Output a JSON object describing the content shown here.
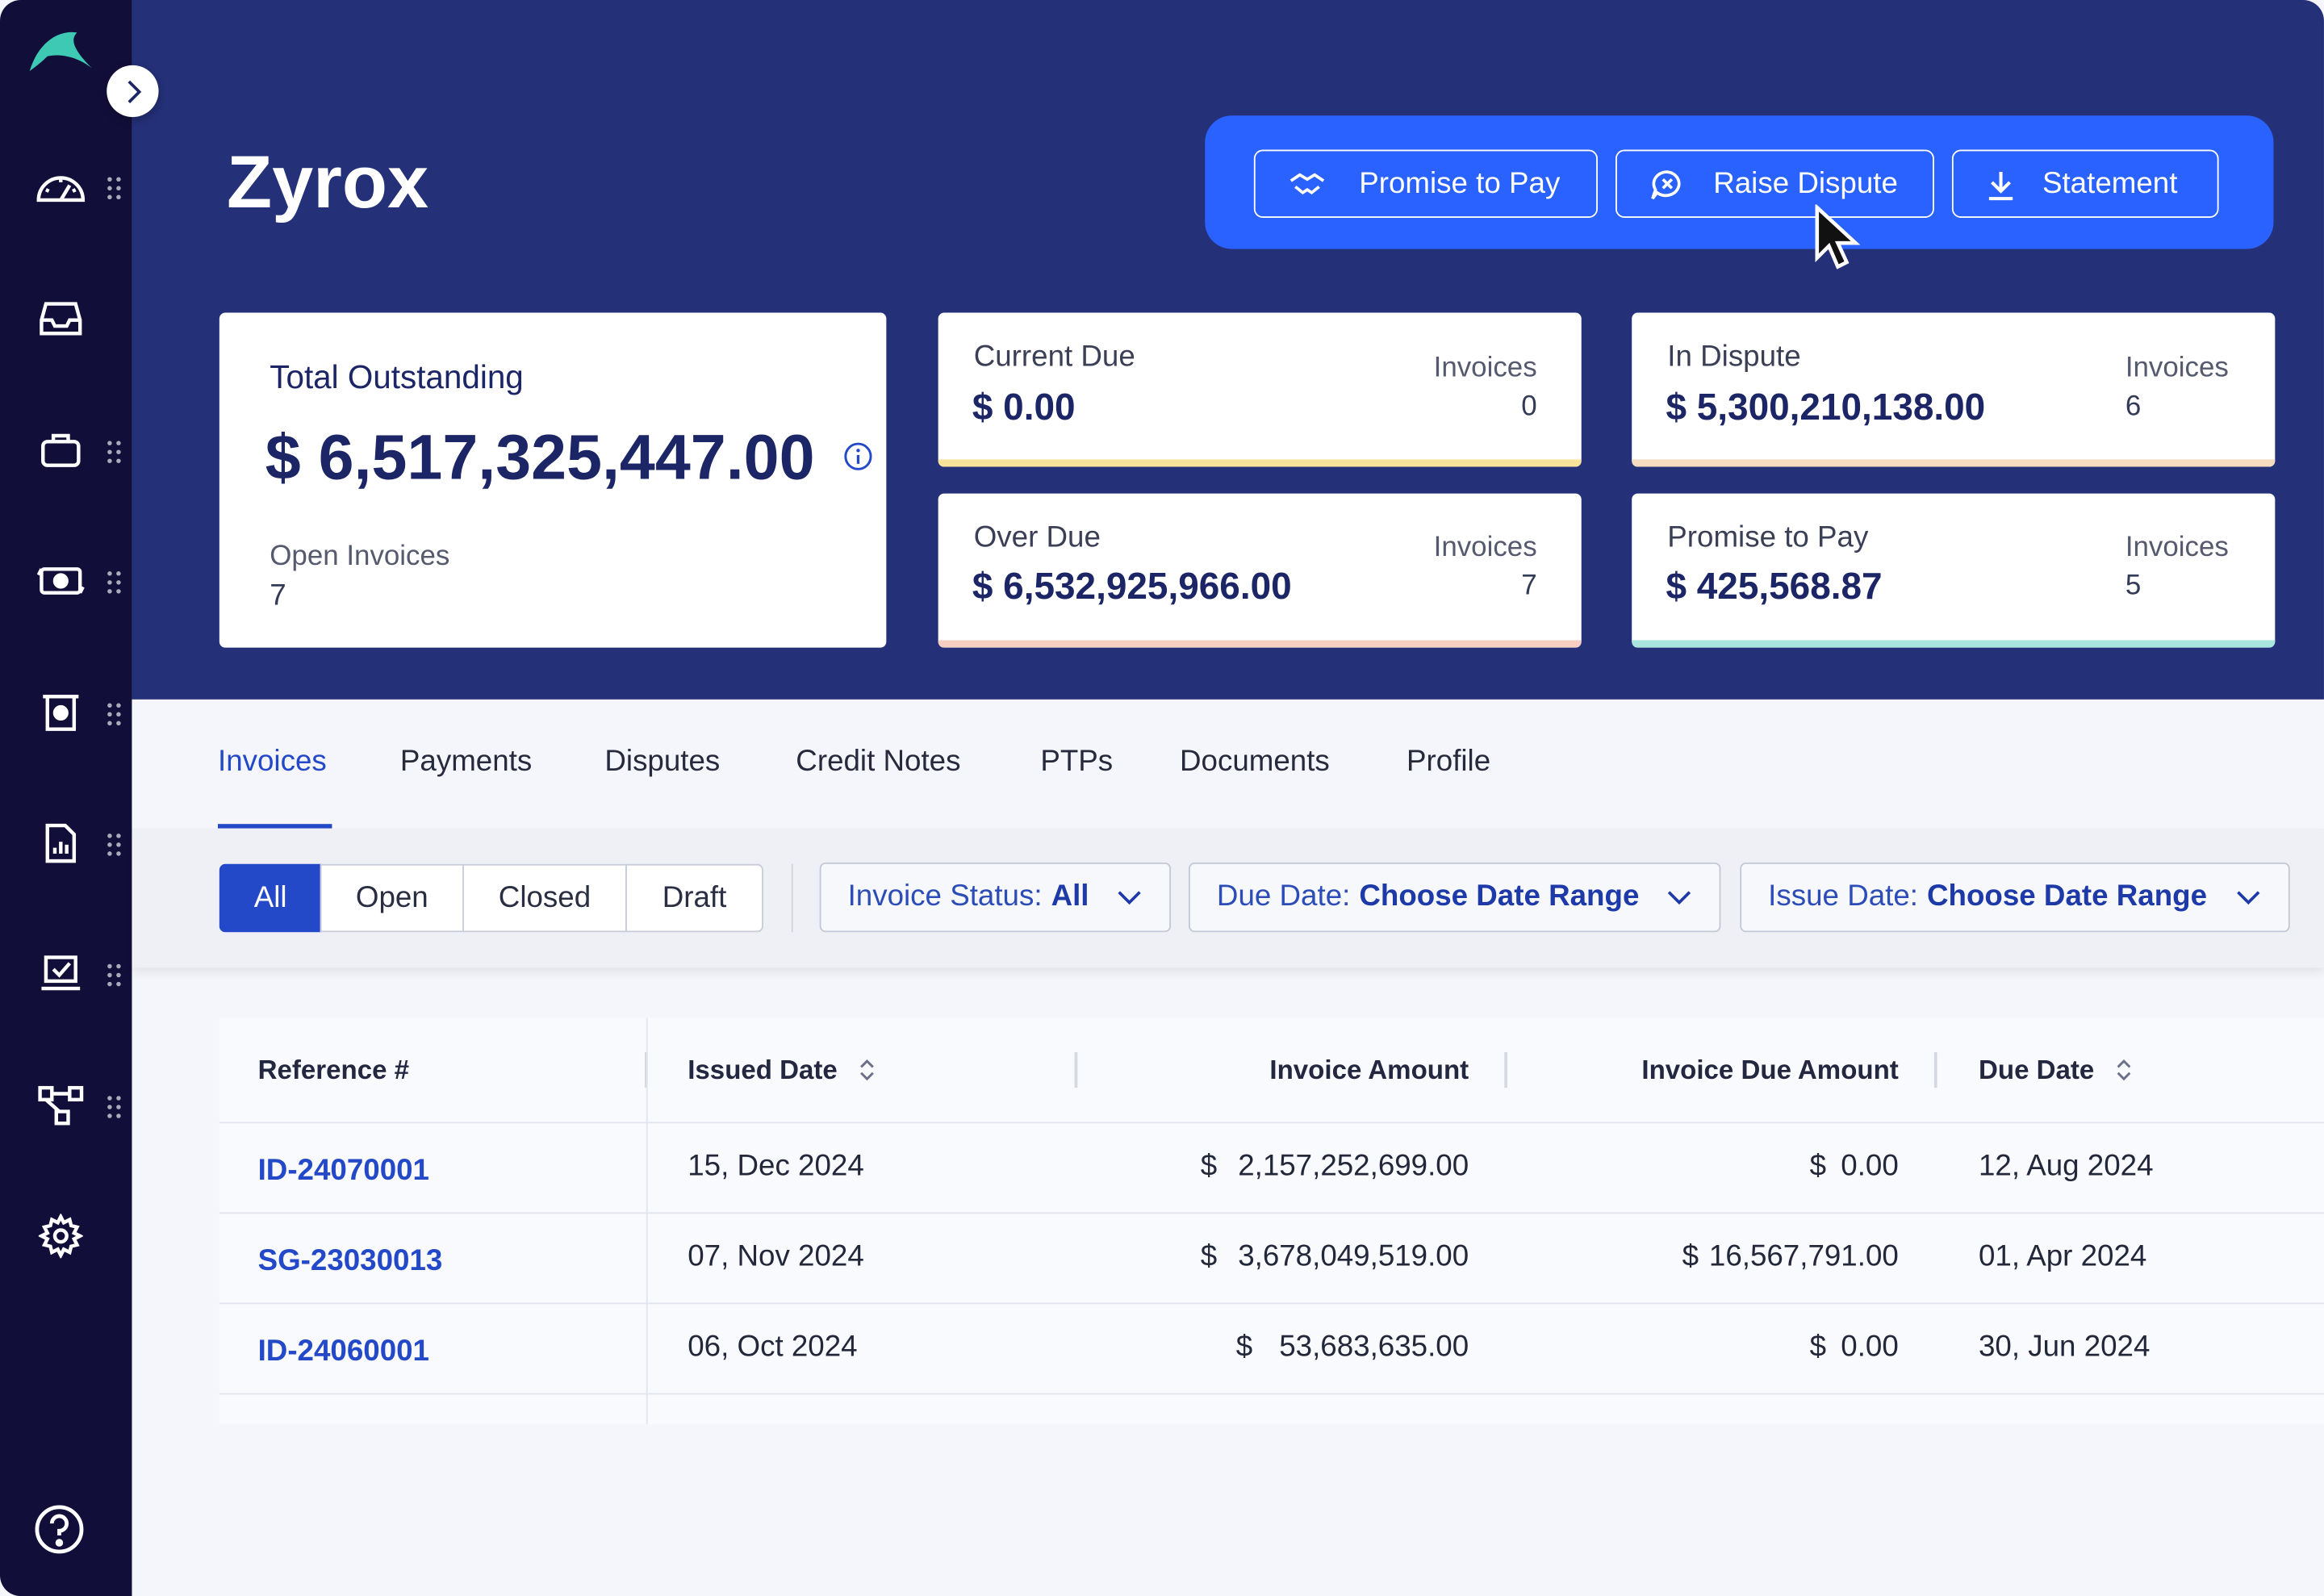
{
  "company": {
    "name": "Zyrox"
  },
  "actions": {
    "promise_to_pay": "Promise to Pay",
    "raise_dispute": "Raise Dispute",
    "statement": "Statement"
  },
  "summary": {
    "total_outstanding": {
      "label": "Total Outstanding",
      "amount": "$ 6,517,325,447.00",
      "open_invoices_label": "Open Invoices",
      "open_invoices": "7"
    },
    "current_due": {
      "label": "Current Due",
      "amount": "$ 0.00",
      "invoices_label": "Invoices",
      "invoices": "0",
      "color": "#f7e39a"
    },
    "in_dispute": {
      "label": "In Dispute",
      "amount": "$ 5,300,210,138.00",
      "invoices_label": "Invoices",
      "invoices": "6",
      "color": "#f5dcc0"
    },
    "over_due": {
      "label": "Over Due",
      "amount": "$ 6,532,925,966.00",
      "invoices_label": "Invoices",
      "invoices": "7",
      "color": "#f7cfc2"
    },
    "promise_to_pay": {
      "label": "Promise to Pay",
      "amount": "$ 425,568.87",
      "invoices_label": "Invoices",
      "invoices": "5",
      "color": "#a9e6dd"
    }
  },
  "tabs": [
    {
      "label": "Invoices",
      "active": true
    },
    {
      "label": "Payments"
    },
    {
      "label": "Disputes"
    },
    {
      "label": "Credit Notes"
    },
    {
      "label": "PTPs"
    },
    {
      "label": "Documents"
    },
    {
      "label": "Profile"
    }
  ],
  "filters": {
    "segments": [
      {
        "label": "All",
        "active": true
      },
      {
        "label": "Open"
      },
      {
        "label": "Closed"
      },
      {
        "label": "Draft"
      }
    ],
    "invoice_status": {
      "label": "Invoice Status:",
      "value": "All"
    },
    "due_date": {
      "label": "Due Date:",
      "value": "Choose Date Range"
    },
    "issue_date": {
      "label": "Issue Date:",
      "value": "Choose Date Range"
    }
  },
  "table": {
    "columns": [
      "Reference #",
      "Issued Date",
      "Invoice Amount",
      "Invoice Due Amount",
      "Due Date"
    ],
    "rows": [
      {
        "ref": "ID-24070001",
        "issued": "15, Dec 2024",
        "amount_sym": "$",
        "amount": "2,157,252,699.00",
        "due_sym": "$",
        "due_amount": "0.00",
        "due_date": "12, Aug 2024"
      },
      {
        "ref": "SG-23030013",
        "issued": "07, Nov 2024",
        "amount_sym": "$",
        "amount": "3,678,049,519.00",
        "due_sym": "$",
        "due_amount": "16,567,791.00",
        "due_date": "01, Apr 2024"
      },
      {
        "ref": "ID-24060001",
        "issued": "06, Oct 2024",
        "amount_sym": "$",
        "amount": "53,683,635.00",
        "due_sym": "$",
        "due_amount": "0.00",
        "due_date": "30, Jun 2024"
      }
    ]
  },
  "sidebar": {
    "items": [
      "dashboard-icon",
      "inbox-icon",
      "briefcase-icon",
      "payments-icon",
      "collections-icon",
      "report-icon",
      "tasks-icon",
      "workflow-icon",
      "settings-icon"
    ],
    "help": "help-icon"
  }
}
